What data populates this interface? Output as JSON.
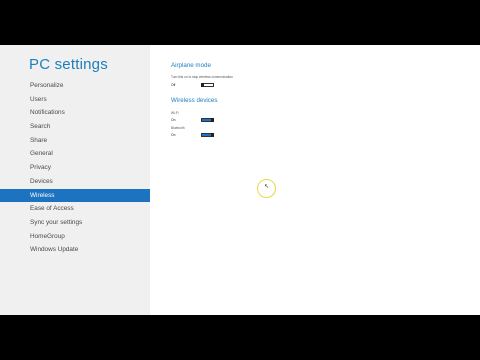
{
  "app": {
    "title": "PC settings"
  },
  "sidebar": {
    "items": [
      {
        "label": "Personalize",
        "selected": false
      },
      {
        "label": "Users",
        "selected": false
      },
      {
        "label": "Notifications",
        "selected": false
      },
      {
        "label": "Search",
        "selected": false
      },
      {
        "label": "Share",
        "selected": false
      },
      {
        "label": "General",
        "selected": false
      },
      {
        "label": "Privacy",
        "selected": false
      },
      {
        "label": "Devices",
        "selected": false
      },
      {
        "label": "Wireless",
        "selected": true
      },
      {
        "label": "Ease of Access",
        "selected": false
      },
      {
        "label": "Sync your settings",
        "selected": false
      },
      {
        "label": "HomeGroup",
        "selected": false
      },
      {
        "label": "Windows Update",
        "selected": false
      }
    ]
  },
  "main": {
    "airplane_mode": {
      "heading": "Airplane mode",
      "caption": "Turn this on to stop wireless communication",
      "state": "Off"
    },
    "wireless_devices": {
      "heading": "Wireless devices",
      "wifi": {
        "label": "Wi-Fi",
        "state": "On"
      },
      "bluetooth": {
        "label": "Bluetooth",
        "state": "On"
      }
    }
  },
  "colors": {
    "accent": "#1e73c0",
    "heading": "#1d7fc0",
    "sidebar_bg": "#f0f0f0",
    "cursor_ring": "#e8d846"
  },
  "icons": {
    "cursor": "pointer-cursor-icon"
  }
}
